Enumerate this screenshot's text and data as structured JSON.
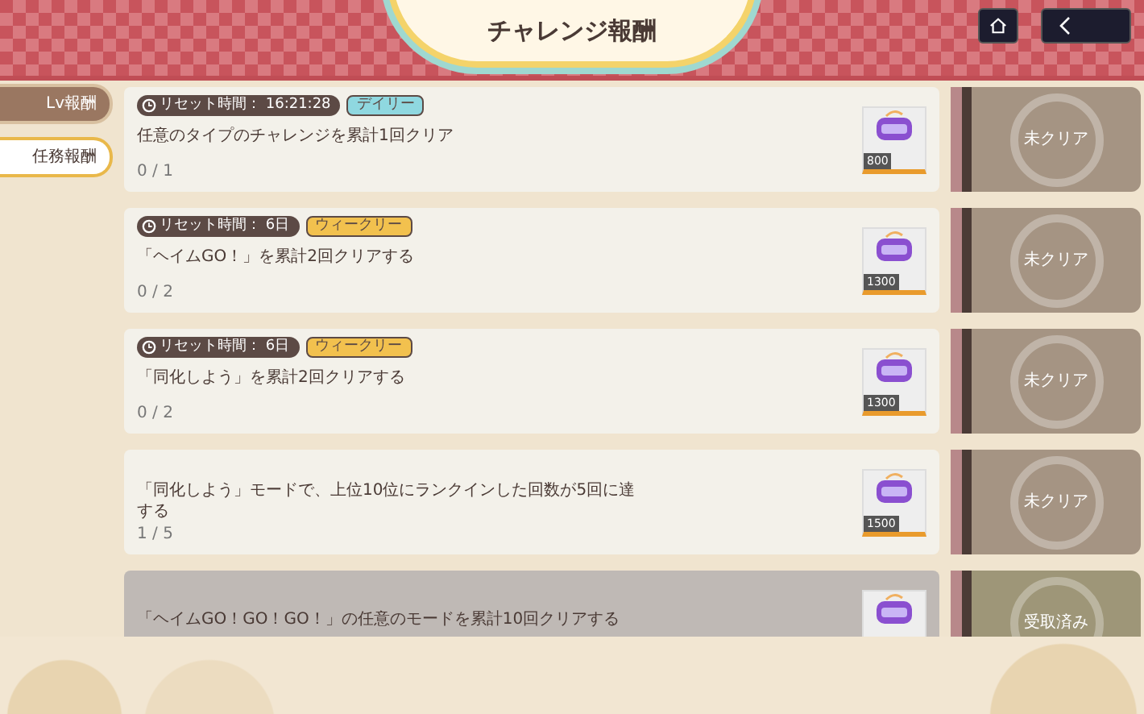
{
  "header": {
    "title": "チャレンジ報酬"
  },
  "side_tabs": [
    {
      "label": "Lv報酬",
      "selected": false
    },
    {
      "label": "任務報酬",
      "selected": true
    }
  ],
  "missions": [
    {
      "reset": "リセット時間： 16:21:28",
      "tag": {
        "label": "デイリー",
        "color": "#8fd8e0"
      },
      "description": "任意のタイプのチャレンジを累計1回クリア",
      "progress": "0 / 1",
      "reward_amount": "800",
      "status": "未クリア",
      "claimed": false
    },
    {
      "reset": "リセット時間： 6日",
      "tag": {
        "label": "ウィークリー",
        "color": "#f2c14e"
      },
      "description": "「ヘイムGO！」を累計2回クリアする",
      "progress": "0 / 2",
      "reward_amount": "1300",
      "status": "未クリア",
      "claimed": false
    },
    {
      "reset": "リセット時間： 6日",
      "tag": {
        "label": "ウィークリー",
        "color": "#f2c14e"
      },
      "description": "「同化しよう」を累計2回クリアする",
      "progress": "0 / 2",
      "reward_amount": "1300",
      "status": "未クリア",
      "claimed": false
    },
    {
      "description": "「同化しよう」モードで、上位10位にランクインした回数が5回に達する",
      "progress": "1 / 5",
      "reward_amount": "1500",
      "status": "未クリア",
      "claimed": false
    },
    {
      "description": "「ヘイムGO！GO！GO！」の任意のモードを累計10回クリアする",
      "status": "受取済み",
      "claimed": true
    }
  ]
}
